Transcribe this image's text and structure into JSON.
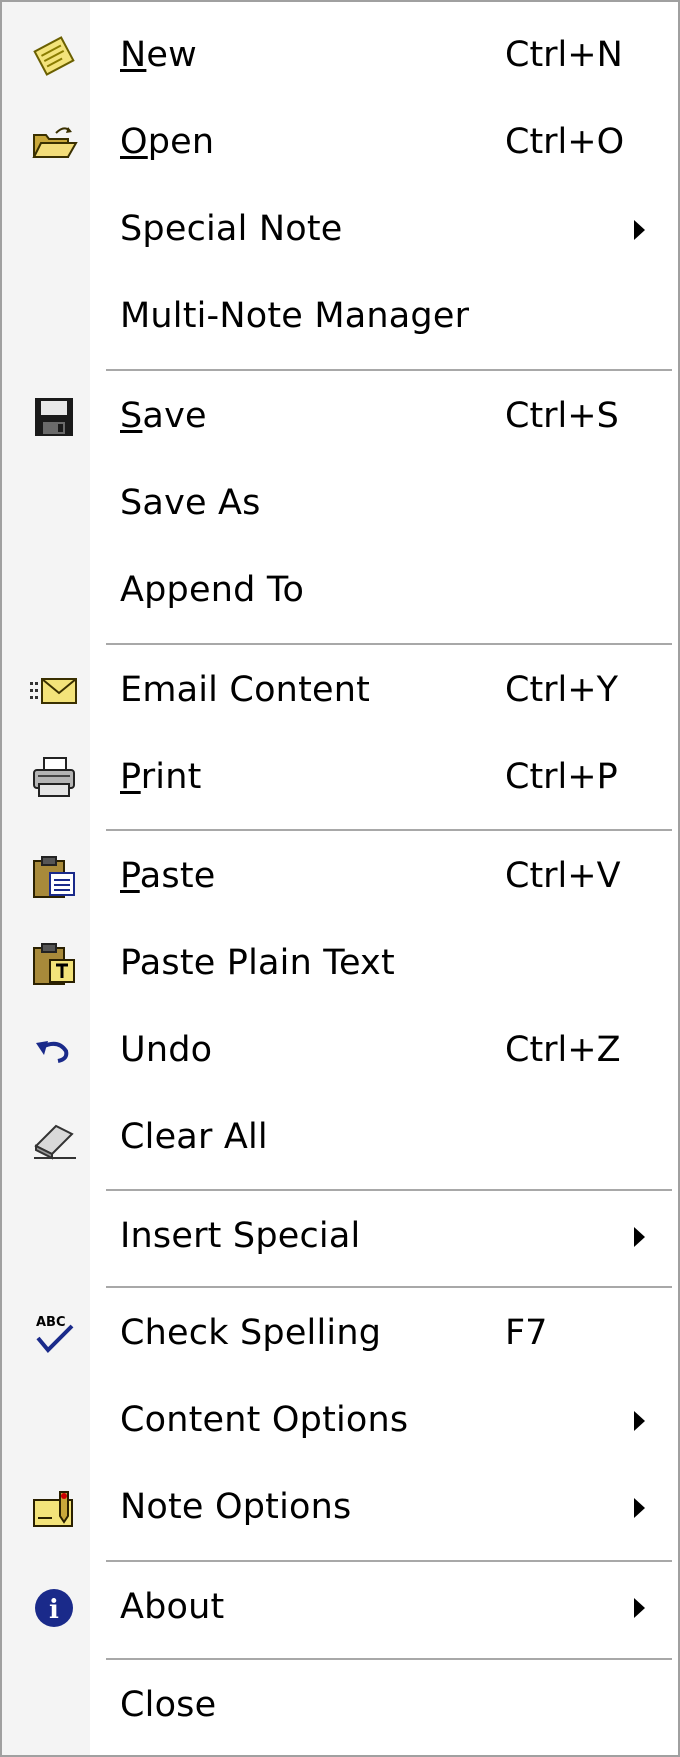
{
  "menu": {
    "items": [
      {
        "pre": "",
        "key": "N",
        "post": "ew",
        "shortcut": "Ctrl+N"
      },
      {
        "pre": "",
        "key": "O",
        "post": "pen",
        "shortcut": "Ctrl+O"
      },
      {
        "label": "Special Note"
      },
      {
        "label": "Multi-Note Manager"
      },
      {
        "pre": "",
        "key": "S",
        "post": "ave",
        "shortcut": "Ctrl+S"
      },
      {
        "label": "Save As"
      },
      {
        "label": "Append To"
      },
      {
        "label": "Email Content",
        "shortcut": "Ctrl+Y"
      },
      {
        "pre": "",
        "key": "P",
        "post": "rint",
        "shortcut": "Ctrl+P"
      },
      {
        "pre": "",
        "key": "P",
        "post": "aste",
        "shortcut": "Ctrl+V"
      },
      {
        "label": "Paste Plain Text"
      },
      {
        "label": "Undo",
        "shortcut": "Ctrl+Z"
      },
      {
        "label": "Clear All"
      },
      {
        "label": "Insert Special"
      },
      {
        "label": "Check Spelling",
        "shortcut": "F7"
      },
      {
        "label": "Content Options"
      },
      {
        "label": "Note Options"
      },
      {
        "label": "About"
      },
      {
        "label": "Close"
      }
    ],
    "icons": {
      "new": "new-note-icon",
      "open": "open-folder-icon",
      "save": "floppy-disk-icon",
      "email": "envelope-icon",
      "print": "printer-icon",
      "paste": "clipboard-paste-icon",
      "paste_plain": "clipboard-plain-icon",
      "undo": "undo-arrow-icon",
      "clear": "eraser-icon",
      "spell": "spell-check-icon",
      "note_options": "note-options-icon",
      "about": "info-icon"
    },
    "spell_icon_text": "ABC",
    "about_icon_text": "i",
    "colors": {
      "gutter": "#f4f4f4",
      "separator": "#a8a8a8",
      "border": "#a0a0a0",
      "icon_blue": "#1a2a8a",
      "icon_yellow": "#f3e37a"
    }
  }
}
